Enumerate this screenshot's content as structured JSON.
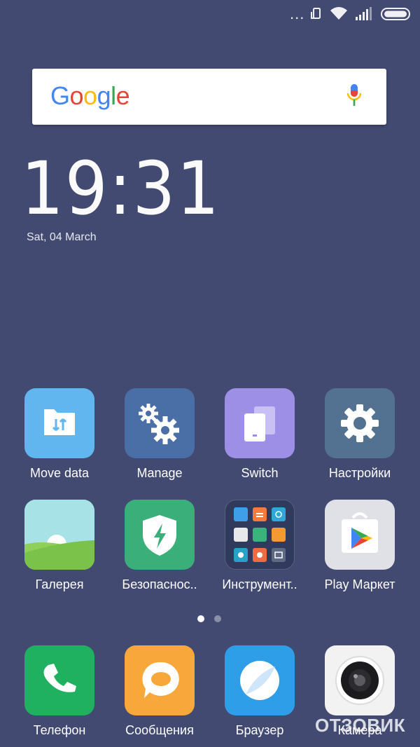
{
  "status_bar": {
    "more_text": "...",
    "icons": [
      "more-dots-icon",
      "rotate-lock-icon",
      "wifi-icon",
      "signal-icon",
      "battery-icon"
    ]
  },
  "search_widget": {
    "logo_text": "Google",
    "logo_colors": [
      "#4285f4",
      "#ea4335",
      "#fbbc05",
      "#4285f4",
      "#34a853",
      "#ea4335"
    ],
    "mic_icon": "mic-icon"
  },
  "clock": {
    "time": "19:31",
    "date": "Sat, 04 March"
  },
  "home_apps_row1": [
    {
      "label": "Move data",
      "icon": "move-data-icon",
      "color": "#62b6f0"
    },
    {
      "label": "Manage",
      "icon": "gears-icon",
      "color": "#4a6ea6"
    },
    {
      "label": "Switch",
      "icon": "switch-icon",
      "color": "#9d8ee6"
    },
    {
      "label": "Настройки",
      "icon": "gear-icon",
      "color": "#537190"
    }
  ],
  "home_apps_row2": [
    {
      "label": "Галерея",
      "icon": "gallery-icon",
      "color": "#a7e3e6"
    },
    {
      "label": "Безопаснос..",
      "icon": "security-icon",
      "color": "#3aaf7a"
    },
    {
      "label": "Инструмент..",
      "icon": "folder-icon",
      "color": "#2f3a5c"
    },
    {
      "label": "Play Маркет",
      "icon": "play-store-icon",
      "color": "#dfe1e6"
    }
  ],
  "pager": {
    "pages": 2,
    "active": 1
  },
  "dock": [
    {
      "label": "Телефон",
      "icon": "phone-icon",
      "color": "#1fb060"
    },
    {
      "label": "Сообщения",
      "icon": "message-icon",
      "color": "#f8a83a"
    },
    {
      "label": "Браузер",
      "icon": "browser-icon",
      "color": "#2f9ee8"
    },
    {
      "label": "Камера",
      "icon": "camera-icon",
      "color": "#f2f2f2"
    }
  ],
  "watermark": "ОТЗОВИК"
}
